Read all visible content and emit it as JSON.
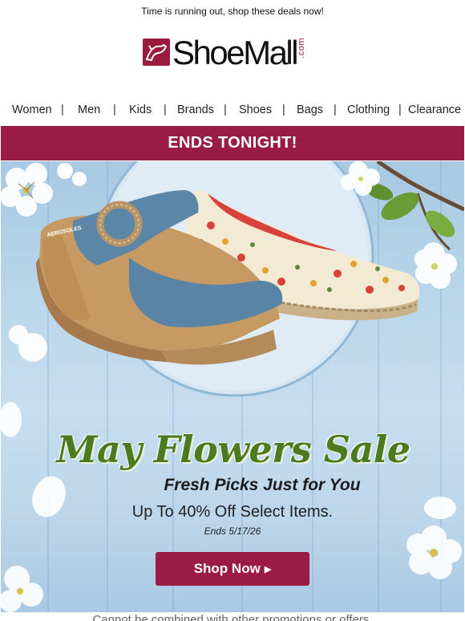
{
  "preheader": "Time is running out, shop these deals now!",
  "logo": {
    "wordmark": "ShoeMall",
    "suffix": ".com"
  },
  "nav": {
    "items": [
      "Women",
      "Men",
      "Kids",
      "Brands",
      "Shoes",
      "Bags",
      "Clothing",
      "Clearance"
    ],
    "separator": "|"
  },
  "banner": {
    "text": "ENDS TONIGHT!"
  },
  "hero": {
    "title": "May Flowers Sale",
    "subtitle": "Fresh Picks Just for You",
    "offer": "Up To 40% Off Select Items.",
    "ends": "Ends 5/17/26",
    "cta_label": "Shop Now",
    "shoe_brand_tag": "AEROSOLES"
  },
  "footer": {
    "disclaimer": "Cannot be combined with other promotions or offers."
  },
  "colors": {
    "brand": "#9b1b47",
    "title_green": "#4d7a1e",
    "hero_blue": "#b9d6ea"
  }
}
